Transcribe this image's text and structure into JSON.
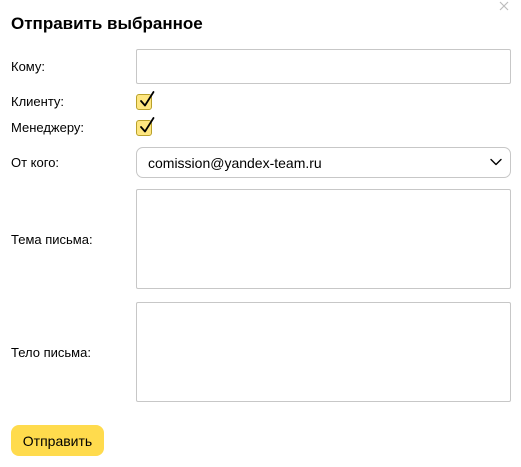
{
  "dialog": {
    "title": "Отправить выбранное",
    "close_icon": "close-icon"
  },
  "form": {
    "to": {
      "label": "Кому:",
      "value": "",
      "placeholder": ""
    },
    "client": {
      "label": "Клиенту:",
      "checked": true
    },
    "manager": {
      "label": "Менеджеру:",
      "checked": true
    },
    "from": {
      "label": "От кого:",
      "value": "comission@yandex-team.ru",
      "icon": "chevron-down-icon"
    },
    "subject": {
      "label": "Тема письма:",
      "value": ""
    },
    "body": {
      "label": "Тело письма:",
      "value": ""
    }
  },
  "actions": {
    "send_label": "Отправить"
  },
  "colors": {
    "accent": "#ffdb4d",
    "checkbox_fill": "#fee680",
    "checkbox_border": "#b9a12b",
    "border": "#c7c7c7"
  }
}
